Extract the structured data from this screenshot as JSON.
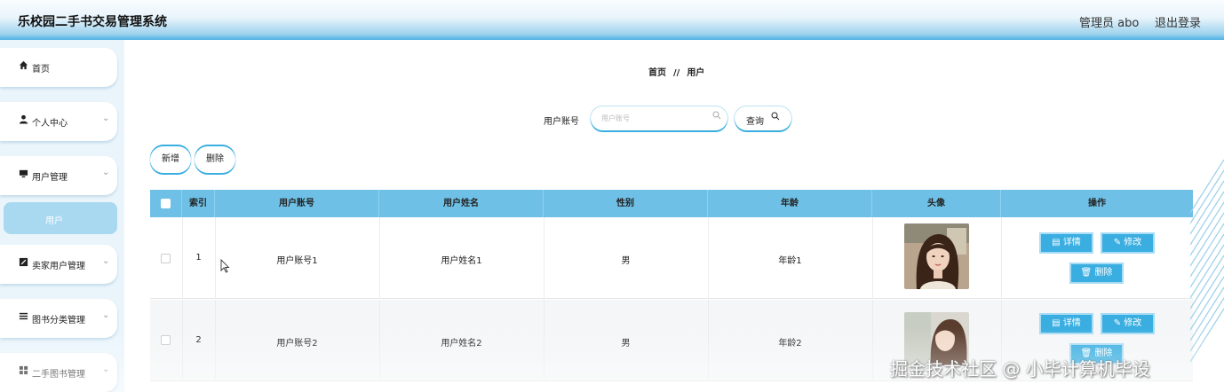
{
  "header": {
    "app_title": "乐校园二手书交易管理系统",
    "admin_label": "管理员 abo",
    "logout_label": "退出登录"
  },
  "sidebar": {
    "items": [
      {
        "label": "首页",
        "icon": "home-icon"
      },
      {
        "label": "个人中心",
        "icon": "user-icon"
      },
      {
        "label": "用户管理",
        "icon": "monitor-icon"
      },
      {
        "label": "卖家用户管理",
        "icon": "edit-square-icon"
      },
      {
        "label": "图书分类管理",
        "icon": "list-icon"
      },
      {
        "label": "二手图书管理",
        "icon": "grid-icon"
      }
    ],
    "active_sub": "用户"
  },
  "breadcrumb": {
    "home": "首页",
    "sep": "//",
    "current": "用户"
  },
  "search": {
    "label": "用户账号",
    "placeholder": "用户账号",
    "query_label": "查询"
  },
  "actions": {
    "add_label": "新增",
    "delete_label": "删除"
  },
  "table": {
    "headers": [
      "索引",
      "用户账号",
      "用户姓名",
      "性别",
      "年龄",
      "头像",
      "操作"
    ],
    "rows": [
      {
        "index": "1",
        "account": "用户账号1",
        "name": "用户姓名1",
        "gender": "男",
        "age": "年龄1"
      },
      {
        "index": "2",
        "account": "用户账号2",
        "name": "用户姓名2",
        "gender": "男",
        "age": "年龄2"
      }
    ],
    "op_labels": {
      "detail": "详情",
      "edit": "修改",
      "delete": "删除"
    }
  },
  "watermark": "掘金技术社区 @ 小毕计算机毕设",
  "colors": {
    "accent": "#3aaee0",
    "table_header": "#6fc0e6",
    "sub_active": "#a8d9f1"
  }
}
